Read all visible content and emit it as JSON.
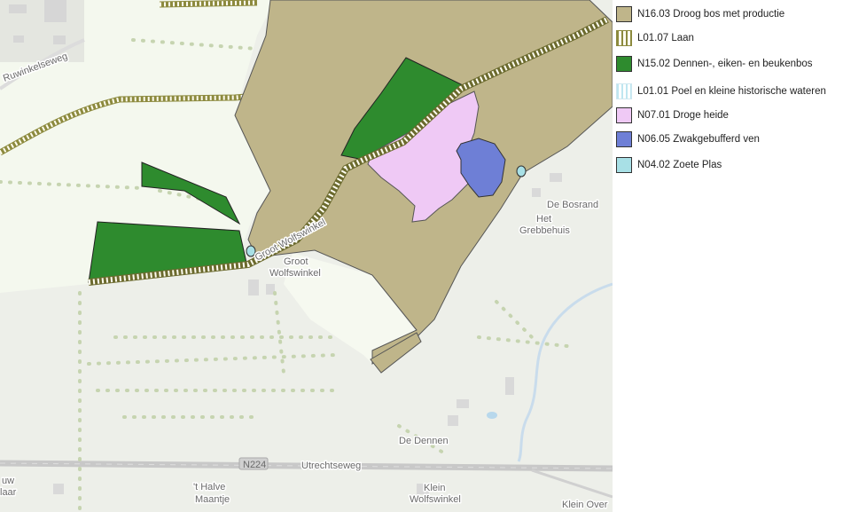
{
  "map": {
    "labels": {
      "ruwinkelseweg": "Ruwinkelseweg",
      "groot_wolfswinkel_road": "Groot Wolfswinkel",
      "groot": "Groot",
      "wolfswinkel": "Wolfswinkel",
      "de_bosrand": "De Bosrand",
      "het": "Het",
      "grebbehuis": "Grebbehuis",
      "de_dennen": "De Dennen",
      "road_shield": "N224",
      "utrechtseweg": "Utrechtseweg",
      "halve": "'t Halve",
      "maantje": "Maantje",
      "klein": "Klein",
      "klein_wolfswinkel": "Wolfswinkel",
      "klein_over": "Klein Over",
      "uw": "uw",
      "laar": "laar"
    },
    "colors": {
      "base": "#f0f2ec",
      "base_light": "#f4f7ef",
      "forest_production": "#bfb58a",
      "pine_oak_beech": "#2e8b2e",
      "heath": "#efc9f5",
      "fen": "#6e7fd6",
      "pool": "#a8e0e6",
      "lane": "#8c8a3e",
      "road": "#c6c6c6"
    }
  },
  "legend": {
    "items": [
      {
        "label": "N16.03 Droog bos met productie",
        "fill": "#bfb58a",
        "pattern": "solid"
      },
      {
        "label": "L01.07 Laan",
        "fill": "#ffffff",
        "pattern": "laan"
      },
      {
        "label": "N15.02 Dennen-, eiken- en beukenbos",
        "fill": "#2e8b2e",
        "pattern": "solid"
      },
      {
        "label": "L01.01 Poel en kleine historische wateren",
        "fill": "#ffffff",
        "pattern": "poel"
      },
      {
        "label": "N07.01 Droge heide",
        "fill": "#efc9f5",
        "pattern": "solid"
      },
      {
        "label": "N06.05 Zwakgebufferd ven",
        "fill": "#6e7fd6",
        "pattern": "solid"
      },
      {
        "label": "N04.02 Zoete Plas",
        "fill": "#a8e0e6",
        "pattern": "solid"
      }
    ]
  }
}
